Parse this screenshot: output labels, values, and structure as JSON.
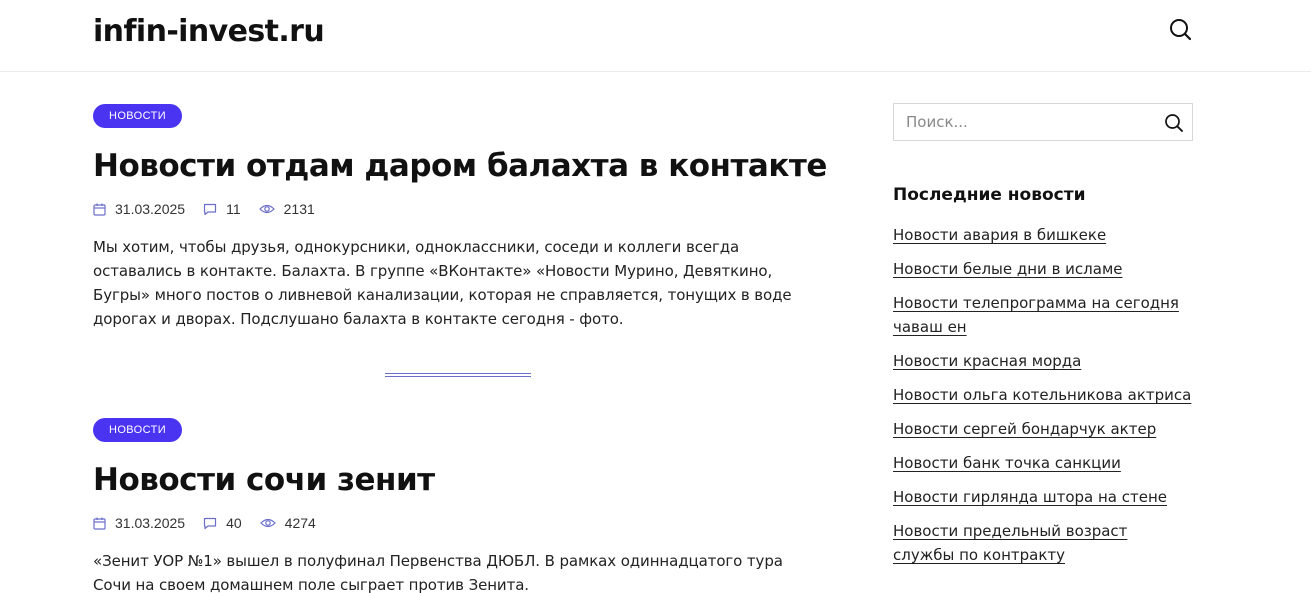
{
  "site": {
    "logo": "infin-invest.ru"
  },
  "posts": [
    {
      "category": "НОВОСТИ",
      "title": "Новости отдам даром балахта в контакте",
      "date": "31.03.2025",
      "comments": "11",
      "views": "2131",
      "excerpt": "Мы хотим, чтобы друзья, однокурсники, одноклассники, соседи и коллеги всегда оставались в контакте. Балахта. В группе «ВКонтакте» «Новости Мурино, Девяткино, Бугры» много постов о ливневой канализации, которая не справляется, тонущих в воде дорогах и дворах. Подслушано балахта в контакте сегодня - фото."
    },
    {
      "category": "НОВОСТИ",
      "title": "Новости сочи зенит",
      "date": "31.03.2025",
      "comments": "40",
      "views": "4274",
      "excerpt": "«Зенит УОР №1» вышел в полуфинал Первенства ДЮБЛ. В рамках одиннадцатого тура Сочи на своем домашнем поле сыграет против Зенита."
    }
  ],
  "sidebar": {
    "search_placeholder": "Поиск...",
    "widget_title": "Последние новости",
    "links": [
      "Новости авария в бишкеке",
      "Новости белые дни в исламе",
      "Новости телепрограмма на сегодня чаваш ен",
      "Новости красная морда",
      "Новости ольга котельникова актриса",
      "Новости сергей бондарчук актер",
      "Новости банк точка санкции",
      "Новости гирлянда штора на стене",
      "Новости предельный возраст службы по контракту"
    ]
  },
  "colors": {
    "accent": "#4a34f2",
    "icon": "#6b6fc9"
  },
  "icons": [
    "search-icon",
    "calendar-icon",
    "comment-icon",
    "eye-icon"
  ]
}
